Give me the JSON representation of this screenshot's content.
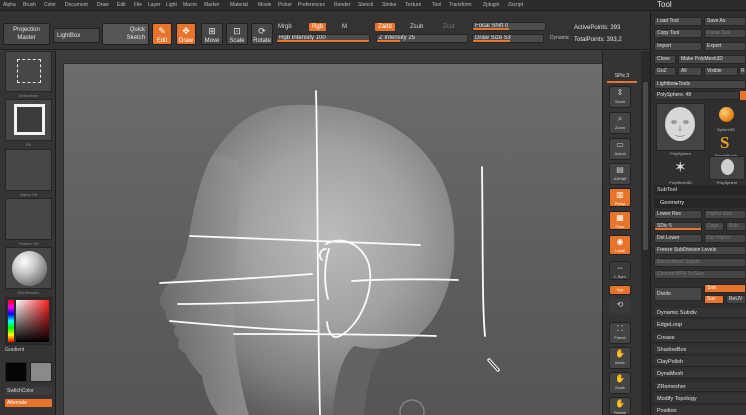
{
  "menubar": {
    "items": [
      "Alpha",
      "Brush",
      "Color",
      "Document",
      "Draw",
      "Edit",
      "File",
      "Layer",
      "Light",
      "Macro",
      "Marker",
      "Material",
      "Movie",
      "Picker",
      "Preferences",
      "Render",
      "Stencil",
      "Stroke",
      "Texture",
      "Tool",
      "Transform",
      "Zplugin",
      "Zscript"
    ],
    "tool_title": "Tool"
  },
  "toolbar": {
    "projection_master": "Projection\nMaster",
    "lightbox": "LightBox",
    "quick_sketch": "Quick\nSketch",
    "edit": "Edit",
    "draw": "Draw",
    "move": "Move",
    "scale": "Scale",
    "rotate": "Rotate",
    "mrgb": "Mrgb",
    "rgb": "Rgb",
    "m": "M",
    "rgb_intensity": "Rgb Intensity 100",
    "zadd": "Zadd",
    "zsub": "Zsub",
    "zcut": "Zcut",
    "z_intensity": "Z Intensity 25",
    "focal_shift": "Focal Shift 0",
    "draw_size": "Draw Size 53",
    "dynamic": "Dynamic",
    "active_points": "ActivePoints: 393",
    "total_points": "TotalPoints: 393,2"
  },
  "left_shelf": {
    "captions": [
      "SelectRect",
      "Fill",
      "Alpha Off",
      "Texture Off",
      "SkinShade4"
    ],
    "gradient": "Gradient",
    "switch_color": "SwitchColor",
    "alternate": "Alternate",
    "colors": {
      "main": "#050505",
      "secondary": "#8a8a8a"
    }
  },
  "right_shelf": {
    "spix": "SPix 3",
    "buttons": [
      "Scroll",
      "Zoom",
      "Actual",
      "AAHalf",
      "Persp",
      "Floor",
      "Local",
      "L.Sym",
      "Xyz",
      "Frame",
      "Move",
      "Scale",
      "Rotate"
    ]
  },
  "tool_panel": {
    "load_tool": "Load Tool",
    "save_as": "Save As",
    "copy_tool": "Copy Tool",
    "paste_tool": "Paste Tool",
    "import": "Import",
    "export": "Export",
    "clone": "Clone",
    "make_polymesh": "Make PolyMesh3D",
    "goz": "GoZ",
    "all": "All",
    "visible": "Visible",
    "r": "R",
    "lightbox_tools": "Lightbox▸Tools",
    "current_tool": "PolySphere. 48",
    "thumbs": [
      "PolySphere",
      "Sphere3D",
      "SimpleBrush",
      "PolyMesh3D",
      "PolySphere"
    ],
    "subtool": "SubTool",
    "geometry": "Geometry",
    "lower_res": "Lower Res",
    "higher_res": "Higher Res",
    "sdiv": "SDiv 5",
    "cage": "Cage",
    "rstr": "Rstr",
    "del_lower": "Del Lower",
    "del_higher": "Del Higher",
    "freeze_subdivision_levels": "Freeze SubDivision Levels",
    "reconstruct_subdiv": "Reconstruct Subdiv",
    "convert_bpr": "Convert BPR To Geo",
    "divide": "Divide",
    "smt": "Smt",
    "suv": "Suv",
    "reluv": "ReUV",
    "sections": [
      "Dynamic Subdiv",
      "EdgeLoop",
      "Crease",
      "ShadowBox",
      "ClayPolish",
      "DynaMesh",
      "ZRemesher",
      "Modify Topology",
      "Position"
    ]
  },
  "colors": {
    "accent": "#e8732a"
  }
}
